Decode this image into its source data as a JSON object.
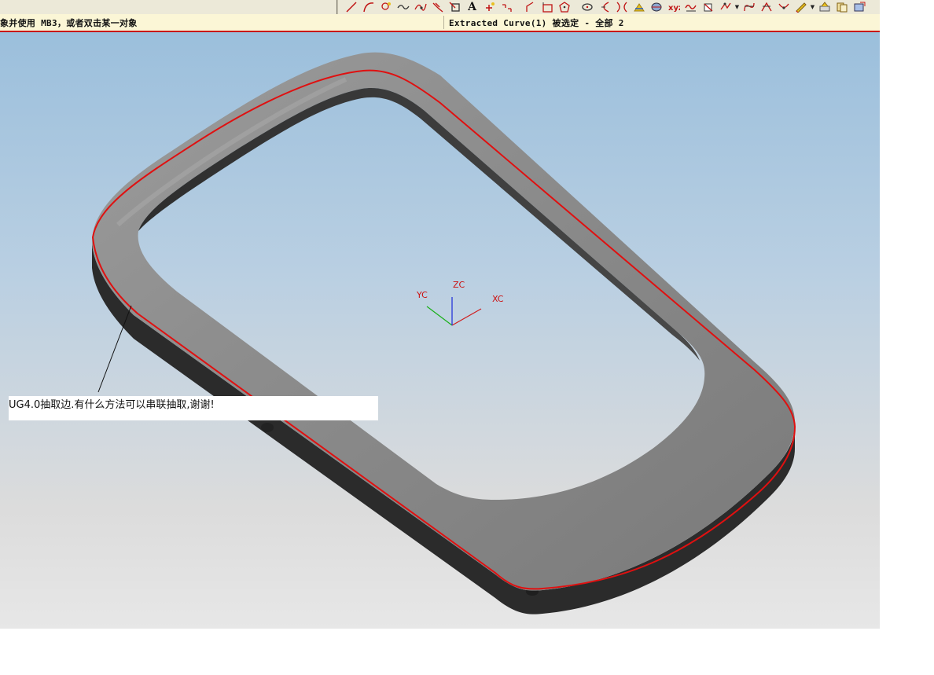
{
  "status": {
    "prompt": "象并使用 MB3，或者双击某一对象",
    "info": "Extracted Curve(1) 被选定 - 全部 2"
  },
  "toolbar": {
    "icons": [
      "line-icon",
      "arc-icon",
      "point-icon",
      "spline-icon",
      "fit-spline-icon",
      "helix-icon",
      "rectangle-icon",
      "text-icon",
      "point-set-icon",
      "offset-icon",
      "divider",
      "fillet-icon",
      "rectangle2-icon",
      "polygon-icon",
      "divider",
      "ellipse-icon",
      "parabola-icon",
      "hyperbola-icon",
      "intersect-curve-icon",
      "section-curve-icon",
      "law-curve-icon",
      "extract-icon",
      "project-icon",
      "combine-icon",
      "bridge-icon",
      "trim-icon",
      "split-icon",
      "edit-icon",
      "edit2-icon",
      "layer-icon",
      "copy-icon",
      "export-icon"
    ],
    "text_icon_label": "A"
  },
  "viewport": {
    "annotation": "UG4.0抽取边.有什么方法可以串联抽取,谢谢!",
    "axes": {
      "xc": "XC",
      "yc": "YC",
      "zc": "ZC"
    },
    "colors": {
      "extracted_curve": "#e01010",
      "axis_x": "#d01c1c",
      "axis_y": "#18b018",
      "axis_z": "#1a2ad8",
      "model_top": "#8d8d8d",
      "model_side": "#2b2b2b"
    }
  }
}
